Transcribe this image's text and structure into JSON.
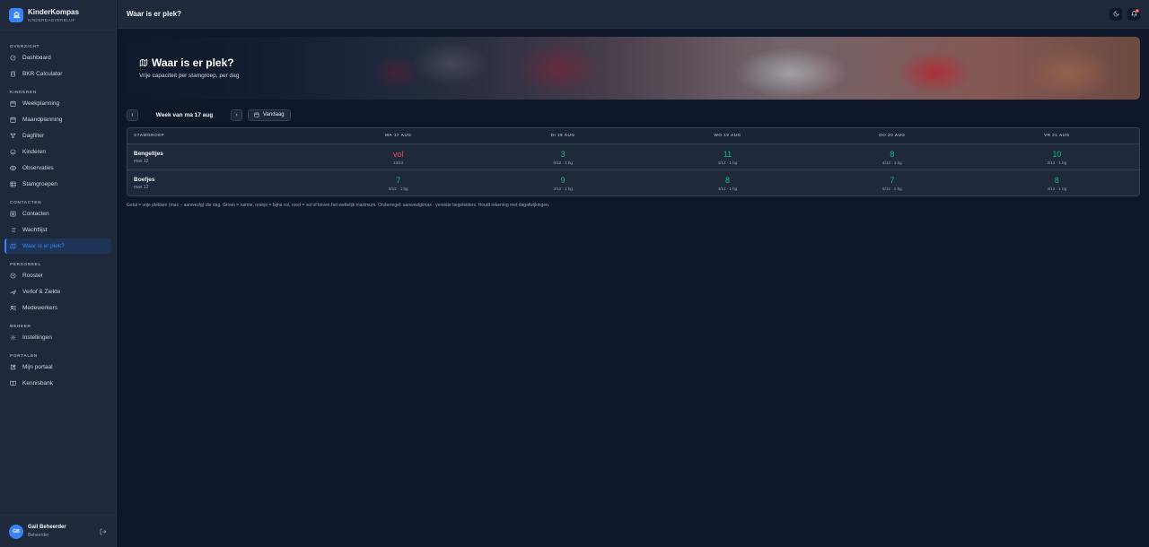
{
  "brand": {
    "name": "KinderKompas",
    "subtitle": "KINDERDAGVERBLIJF"
  },
  "sidebar": {
    "sections": [
      {
        "title": "OVERZICHT",
        "items": [
          {
            "label": "Dashboard",
            "icon": "dashboard-icon"
          },
          {
            "label": "BKR Calculator",
            "icon": "calculator-icon"
          }
        ]
      },
      {
        "title": "KINDEREN",
        "items": [
          {
            "label": "Weekplanning",
            "icon": "calendar-icon"
          },
          {
            "label": "Maandplanning",
            "icon": "calendar-icon"
          },
          {
            "label": "Dagfilter",
            "icon": "filter-icon"
          },
          {
            "label": "Kinderen",
            "icon": "smile-icon"
          },
          {
            "label": "Observaties",
            "icon": "eye-icon"
          },
          {
            "label": "Stamgroepen",
            "icon": "grid-icon"
          }
        ]
      },
      {
        "title": "CONTACTEN",
        "items": [
          {
            "label": "Contacten",
            "icon": "contacts-icon"
          },
          {
            "label": "Wachtlijst",
            "icon": "list-icon"
          },
          {
            "label": "Waar is er plek?",
            "icon": "map-icon",
            "active": true
          }
        ]
      },
      {
        "title": "PERSONEEL",
        "items": [
          {
            "label": "Rooster",
            "icon": "clock-icon"
          },
          {
            "label": "Verlof & Ziekte",
            "icon": "plane-icon"
          },
          {
            "label": "Medewerkers",
            "icon": "users-icon"
          }
        ]
      },
      {
        "title": "BEHEER",
        "items": [
          {
            "label": "Instellingen",
            "icon": "gear-icon"
          }
        ]
      },
      {
        "title": "PORTALEN",
        "items": [
          {
            "label": "Mijn portaal",
            "icon": "portal-icon"
          },
          {
            "label": "Kennisbank",
            "icon": "book-icon"
          }
        ]
      }
    ]
  },
  "user": {
    "initials": "GB",
    "name": "Gail Beheerder",
    "role": "Beheerder"
  },
  "header": {
    "title": "Waar is er plek?",
    "notifications": "3"
  },
  "hero": {
    "title": "Waar is er plek?",
    "subtitle": "Vrije capaciteit per stamgroep, per dag"
  },
  "week": {
    "label": "Week van ma 17 aug",
    "prev": "‹",
    "next": "›",
    "today_label": "Vandaag"
  },
  "table": {
    "group_header": "STAMGROEP",
    "days": [
      "MA 17 AUG",
      "DI 18 AUG",
      "WO 19 AUG",
      "DO 20 AUG",
      "VR 21 AUG"
    ],
    "rows": [
      {
        "name": "Bengeltjes",
        "max": "max 12",
        "cells": [
          {
            "value": "vol",
            "sub": "13/12",
            "status": "red"
          },
          {
            "value": "3",
            "sub": "9/12 · 2 bg",
            "status": "green"
          },
          {
            "value": "11",
            "sub": "1/12 · 1 bg",
            "status": "green"
          },
          {
            "value": "8",
            "sub": "4/12 · 1 bg",
            "status": "green"
          },
          {
            "value": "10",
            "sub": "2/12 · 1 bg",
            "status": "green"
          }
        ]
      },
      {
        "name": "Boefjes",
        "max": "max 12",
        "cells": [
          {
            "value": "7",
            "sub": "5/12 · 1 bg",
            "status": "green"
          },
          {
            "value": "9",
            "sub": "3/12 · 1 bg",
            "status": "green"
          },
          {
            "value": "8",
            "sub": "4/12 · 1 bg",
            "status": "green"
          },
          {
            "value": "7",
            "sub": "5/12 · 2 bg",
            "status": "green"
          },
          {
            "value": "8",
            "sub": "4/12 · 1 bg",
            "status": "green"
          }
        ]
      }
    ]
  },
  "legend": "Getal = vrije plekken (max − aanwezig) die dag. Groen = ruimte, oranje = bijna vol, rood = vol of boven het wettelijk maximum. Onderregel: aanwezig/max · vereiste begeleiders. Houdt rekening met dagafwijkingen.",
  "colors": {
    "accent": "#3b82f6",
    "green": "#10b981",
    "red": "#f43f5e"
  }
}
